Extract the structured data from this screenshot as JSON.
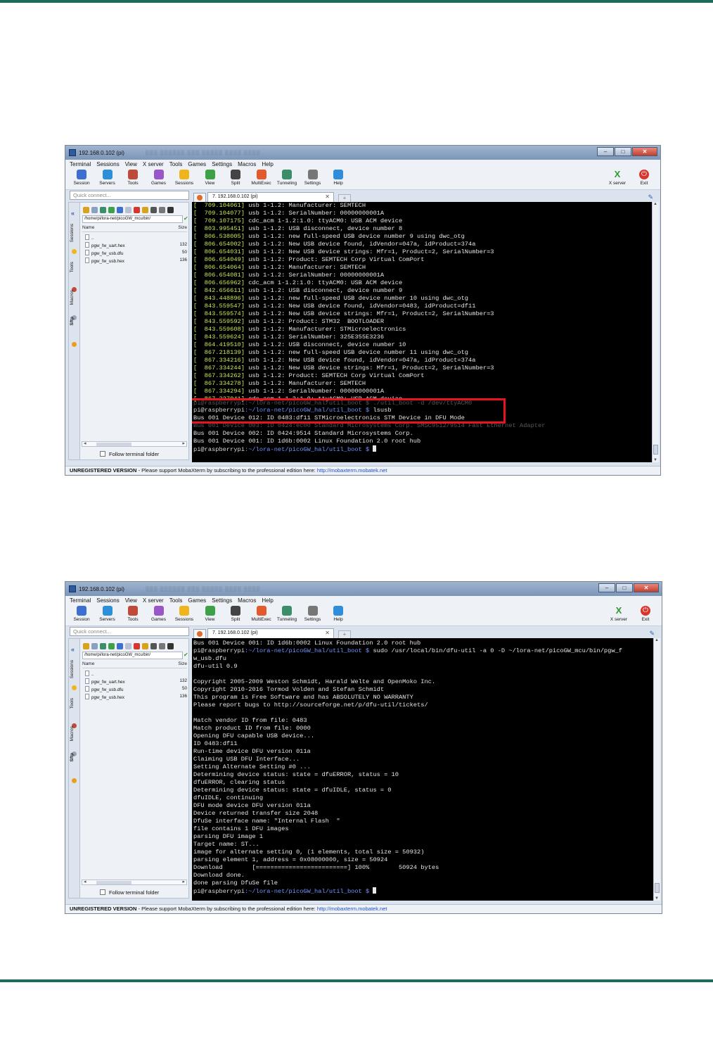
{
  "colors": {
    "rule": "#1d6b58",
    "terminal_bg": "#000000",
    "timestamp": "#c8e85a",
    "prompt_path": "#6f93ff",
    "highlight_box": "#e8131d"
  },
  "window": {
    "title": "192.168.0.102 (pi)",
    "menu": [
      "Terminal",
      "Sessions",
      "View",
      "X server",
      "Tools",
      "Games",
      "Settings",
      "Macros",
      "Help"
    ],
    "toolbar": [
      {
        "label": "Session",
        "icon": "session-icon",
        "color": "#3d6fd1"
      },
      {
        "label": "Servers",
        "icon": "servers-icon",
        "color": "#2d8fd8"
      },
      {
        "label": "Tools",
        "icon": "tools-icon",
        "color": "#c04a3a"
      },
      {
        "label": "Games",
        "icon": "games-icon",
        "color": "#9a56c8"
      },
      {
        "label": "Sessions",
        "icon": "star-icon",
        "color": "#f0b51c"
      },
      {
        "label": "View",
        "icon": "view-icon",
        "color": "#3ea047"
      },
      {
        "label": "Split",
        "icon": "split-icon",
        "color": "#444444"
      },
      {
        "label": "MultiExec",
        "icon": "multiexec-icon",
        "color": "#e35b2d"
      },
      {
        "label": "Tunneling",
        "icon": "tunneling-icon",
        "color": "#3a8f6a"
      },
      {
        "label": "Settings",
        "icon": "settings-icon",
        "color": "#777777"
      },
      {
        "label": "Help",
        "icon": "help-icon",
        "color": "#2f8ddb"
      }
    ],
    "xserver_label": "X server",
    "exit_label": "Exit",
    "quick_connect_placeholder": "Quick connect...",
    "session_tab": "7. 192.168.0.102 (pi)",
    "side_tabs": [
      "Sessions",
      "Tools",
      "Macros",
      "Sftp"
    ],
    "sftp": {
      "path": "/home/pi/lora-net/picoGW_mcu/bin/",
      "col_name": "Name",
      "col_size": "Size",
      "files": [
        {
          "name": "..",
          "size": ""
        },
        {
          "name": "pgw_fw_uart.hex",
          "size": "132"
        },
        {
          "name": "pgw_fw_usb.dfu",
          "size": "50"
        },
        {
          "name": "pgw_fw_usb.hex",
          "size": "136"
        }
      ],
      "follow_label": "Follow terminal folder"
    },
    "status": {
      "unregistered": "UNREGISTERED VERSION",
      "message": "  -  Please support MobaXterm by subscribing to the professional edition here:  ",
      "link": "http://mobaxterm.mobatek.net"
    }
  },
  "terminal1": {
    "log": [
      {
        "ts": "[  709.104061]",
        "msg": " usb 1-1.2: Manufacturer: SEMTECH"
      },
      {
        "ts": "[  709.104077]",
        "msg": " usb 1-1.2: SerialNumber: 00000000001A"
      },
      {
        "ts": "[  709.107175]",
        "msg": " cdc_acm 1-1.2:1.0: ttyACM0: USB ACM device"
      },
      {
        "ts": "[  803.995451]",
        "msg": " usb 1-1.2: USB disconnect, device number 8"
      },
      {
        "ts": "[  806.538005]",
        "msg": " usb 1-1.2: new full-speed USB device number 9 using dwc_otg"
      },
      {
        "ts": "[  806.654002]",
        "msg": " usb 1-1.2: New USB device found, idVendor=047a, idProduct=374a"
      },
      {
        "ts": "[  806.654031]",
        "msg": " usb 1-1.2: New USB device strings: Mfr=1, Product=2, SerialNumber=3"
      },
      {
        "ts": "[  806.654049]",
        "msg": " usb 1-1.2: Product: SEMTECH Corp Virtual ComPort"
      },
      {
        "ts": "[  806.654064]",
        "msg": " usb 1-1.2: Manufacturer: SEMTECH"
      },
      {
        "ts": "[  806.654081]",
        "msg": " usb 1-1.2: SerialNumber: 00000000001A"
      },
      {
        "ts": "[  806.656962]",
        "msg": " cdc_acm 1-1.2:1.0: ttyACM0: USB ACM device"
      },
      {
        "ts": "[  842.656611]",
        "msg": " usb 1-1.2: USB disconnect, device number 9"
      },
      {
        "ts": "[  843.448896]",
        "msg": " usb 1-1.2: new full-speed USB device number 10 using dwc_otg"
      },
      {
        "ts": "[  843.559547]",
        "msg": " usb 1-1.2: New USB device found, idVendor=0483, idProduct=df11"
      },
      {
        "ts": "[  843.559574]",
        "msg": " usb 1-1.2: New USB device strings: Mfr=1, Product=2, SerialNumber=3"
      },
      {
        "ts": "[  843.559592]",
        "msg": " usb 1-1.2: Product: STM32  BOOTLOADER"
      },
      {
        "ts": "[  843.559608]",
        "msg": " usb 1-1.2: Manufacturer: STMicroelectronics"
      },
      {
        "ts": "[  843.559624]",
        "msg": " usb 1-1.2: SerialNumber: 325E355E3236"
      },
      {
        "ts": "[  864.419510]",
        "msg": " usb 1-1.2: USB disconnect, device number 10"
      },
      {
        "ts": "[  867.218139]",
        "msg": " usb 1-1.2: new full-speed USB device number 11 using dwc_otg"
      },
      {
        "ts": "[  867.334216]",
        "msg": " usb 1-1.2: New USB device found, idVendor=047a, idProduct=374a"
      },
      {
        "ts": "[  867.334244]",
        "msg": " usb 1-1.2: New USB device strings: Mfr=1, Product=2, SerialNumber=3"
      },
      {
        "ts": "[  867.334262]",
        "msg": " usb 1-1.2: Product: SEMTECH Corp Virtual ComPort"
      },
      {
        "ts": "[  867.334278]",
        "msg": " usb 1-1.2: Manufacturer: SEMTECH"
      },
      {
        "ts": "[  867.334294]",
        "msg": " usb 1-1.2: SerialNumber: 00000000001A"
      },
      {
        "ts": "[  867.337041]",
        "msg": " cdc_acm 1-1.2:1.0: ttyACM0: USB ACM device"
      }
    ],
    "overlap_a": "pi@raspberrypi:~/lora-net/picoGW_hal/util_boot $ ./util_boot -d /dev/ttyACM0",
    "prompt_user": "pi@raspberrypi",
    "prompt_path": ":~/lora-net/picoGW_hal/util_boot $ ",
    "cmd_lsusb": "lsusb",
    "bus_dfu": "Bus 001 Device 012: ID 0483:df11 STMicroelectronics STM Device in DFU Mode",
    "bus_ethernet": "Bus 001 Device 003: ID 0424:ec00 Standard Microsystems Corp. SMSC9512/9514 Fast Ethernet Adapter",
    "bus_hub9514": "Bus 001 Device 002: ID 0424:9514 Standard Microsystems Corp.",
    "bus_roothub": "Bus 001 Device 001: ID 1d6b:0002 Linux Foundation 2.0 root hub"
  },
  "terminal2": {
    "first_line": "Bus 001 Device 001: ID 1d6b:0002 Linux Foundation 2.0 root hub",
    "prompt_user": "pi@raspberrypi",
    "prompt_path": ":~/lora-net/picoGW_hal/util_boot $ ",
    "dfu_cmd": "sudo /usr/local/bin/dfu-util -a 0 -D ~/lora-net/picoGW_mcu/bin/pgw_f",
    "dfu_cmd_wrap": "w_usb.dfu",
    "output": [
      "dfu-util 0.9",
      "",
      "Copyright 2005-2009 Weston Schmidt, Harald Welte and OpenMoko Inc.",
      "Copyright 2010-2016 Tormod Volden and Stefan Schmidt",
      "This program is Free Software and has ABSOLUTELY NO WARRANTY",
      "Please report bugs to http://sourceforge.net/p/dfu-util/tickets/",
      "",
      "Match vendor ID from file: 0483",
      "Match product ID from file: 0000",
      "Opening DFU capable USB device...",
      "ID 0483:df11",
      "Run-time device DFU version 011a",
      "Claiming USB DFU Interface...",
      "Setting Alternate Setting #0 ...",
      "Determining device status: state = dfuERROR, status = 10",
      "dfuERROR, clearing status",
      "Determining device status: state = dfuIDLE, status = 0",
      "dfuIDLE, continuing",
      "DFU mode device DFU version 011a",
      "Device returned transfer size 2048",
      "DfuSe interface name: \"Internal Flash  \"",
      "file contains 1 DFU images",
      "parsing DFU image 1",
      "Target name: ST...",
      "image for alternate setting 0, (1 elements, total size = 50932)",
      "parsing element 1, address = 0x08000000, size = 50924",
      "Download        [=========================] 100%        50924 bytes",
      "Download done.",
      "done parsing DfuSe file"
    ]
  }
}
